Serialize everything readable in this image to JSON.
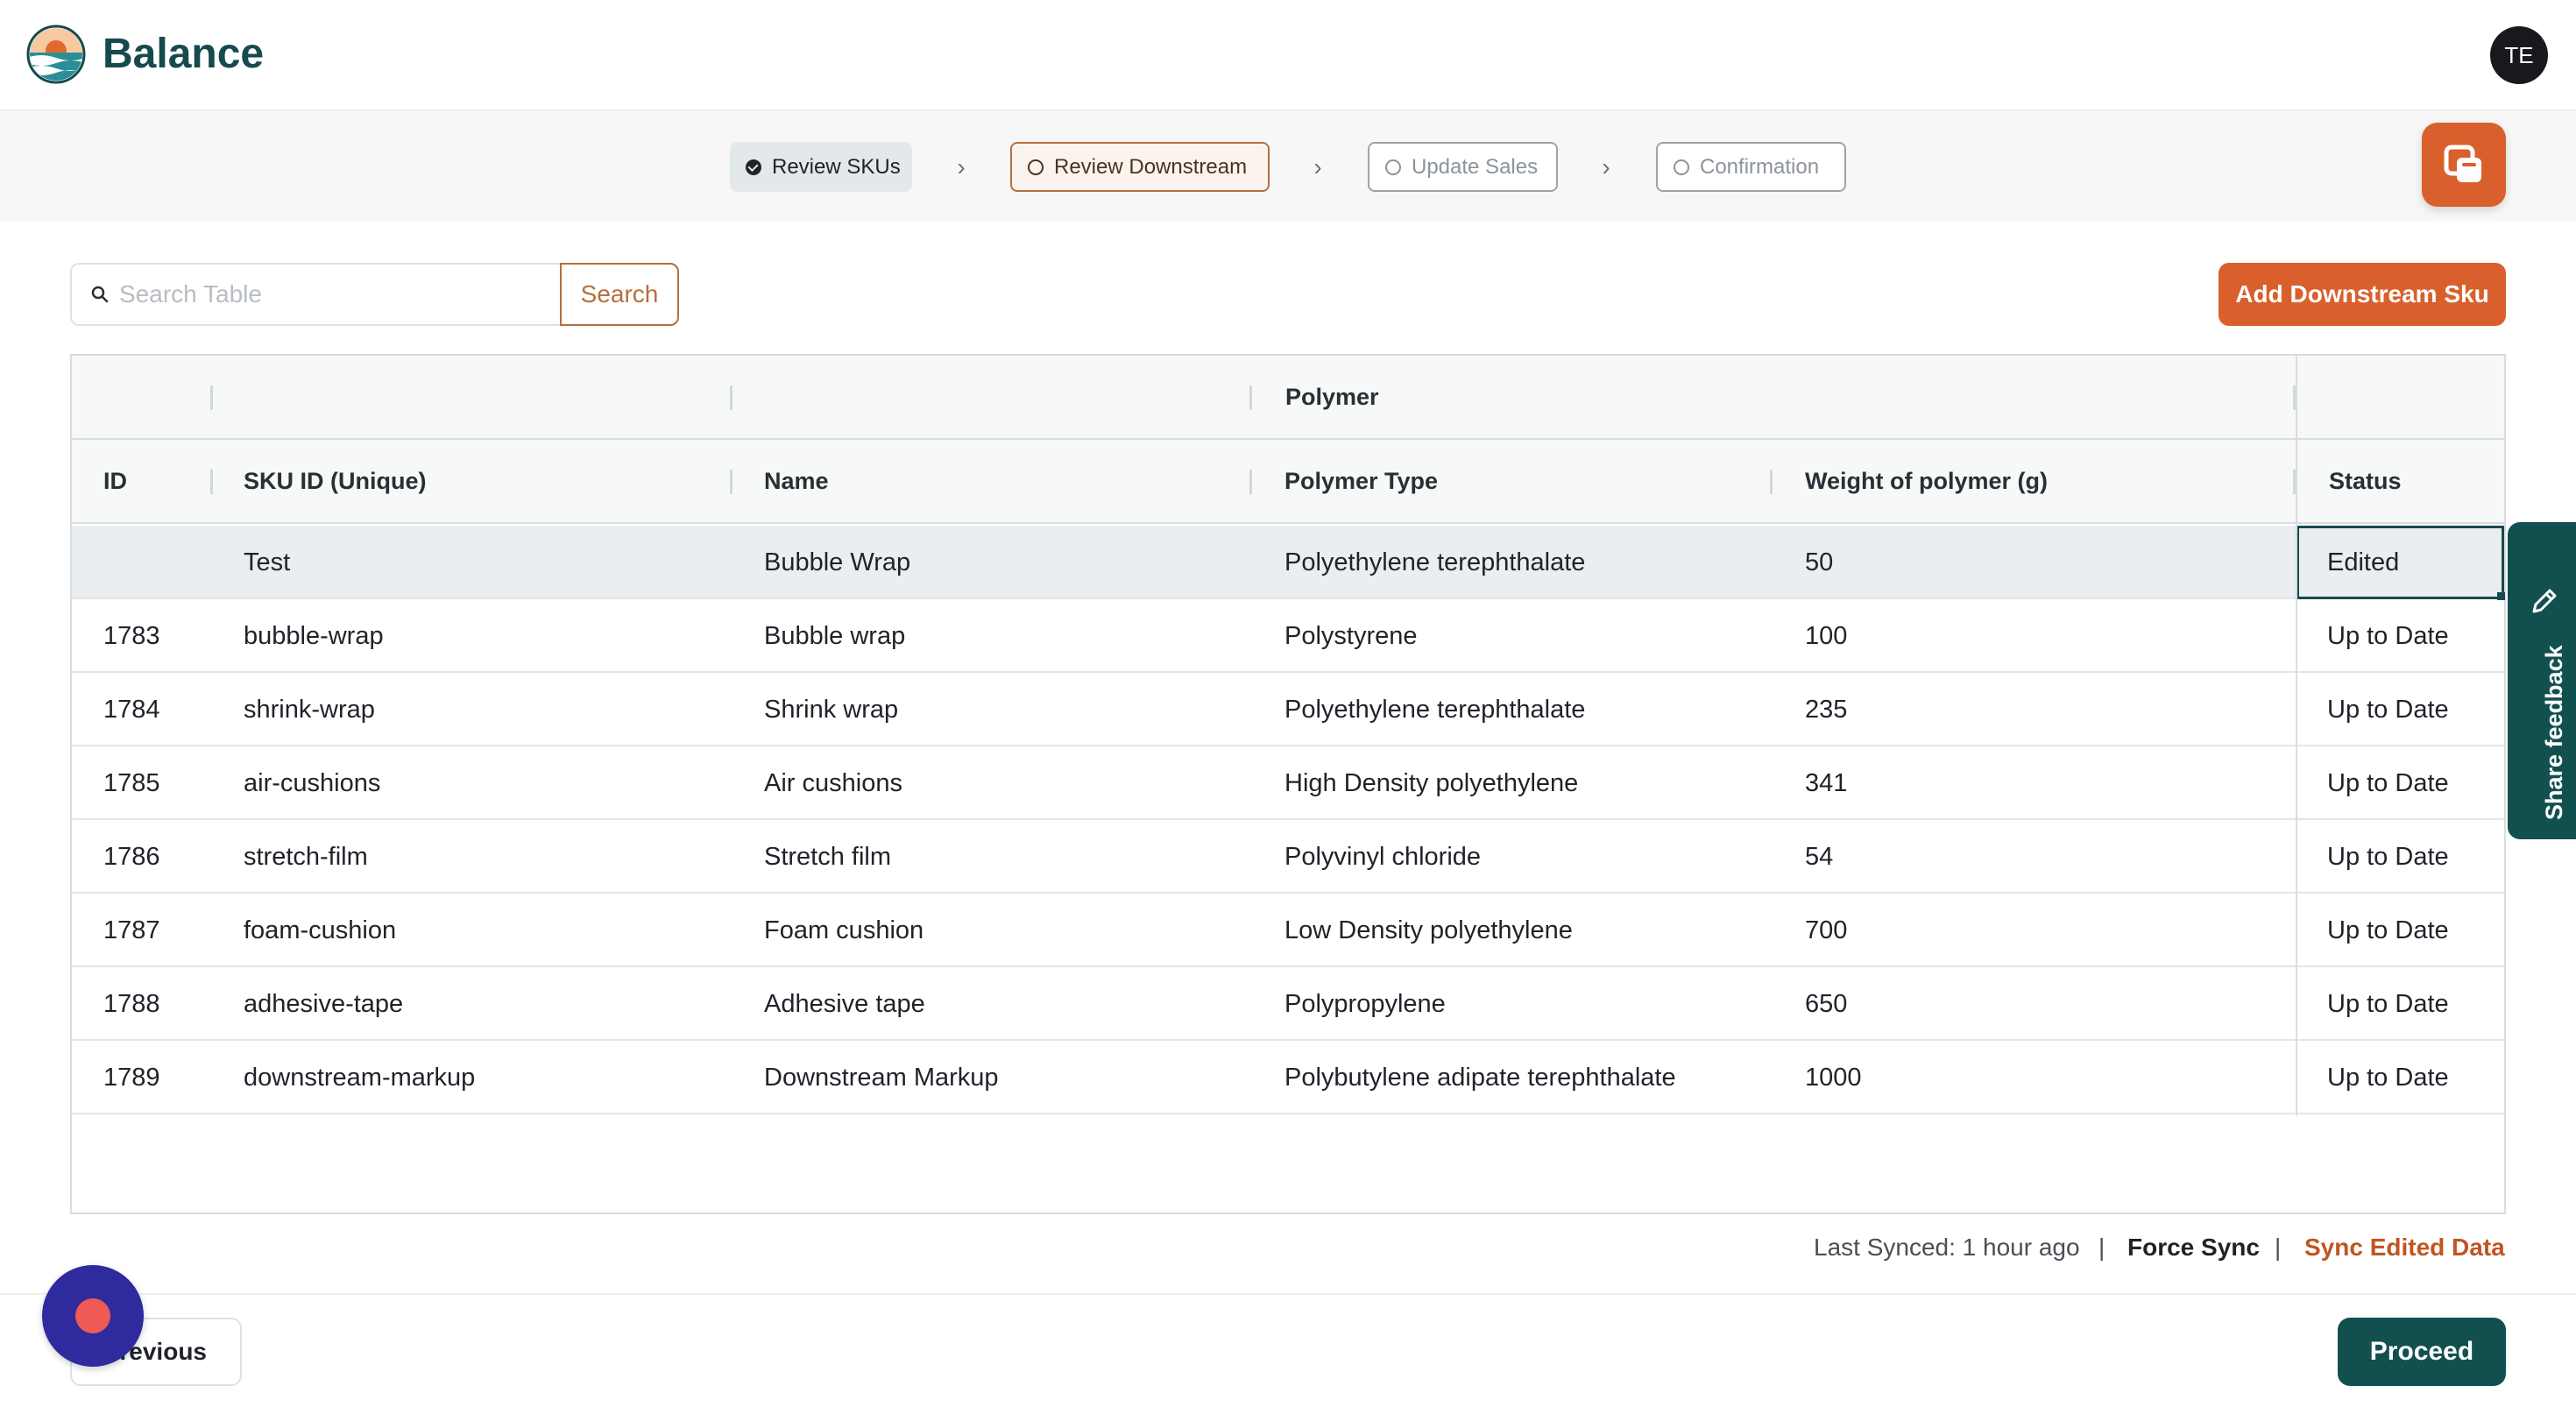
{
  "header": {
    "brand": "Balance",
    "avatar_initials": "TE"
  },
  "stepper": {
    "steps": [
      {
        "label": "Review SKUs",
        "state": "done"
      },
      {
        "label": "Review Downstream",
        "state": "active"
      },
      {
        "label": "Update Sales",
        "state": "pending"
      },
      {
        "label": "Confirmation",
        "state": "pending"
      }
    ],
    "separator_icon": "chevron-right-icon"
  },
  "toolbar": {
    "search_placeholder": "Search Table",
    "search_value": "",
    "search_label": "Search",
    "add_label": "Add Downstream Sku"
  },
  "table": {
    "group_header": "Polymer",
    "columns": [
      "ID",
      "SKU ID (Unique)",
      "Name",
      "Polymer Type",
      "Weight of polymer (g)",
      "Status"
    ],
    "rows": [
      [
        "",
        "Test",
        "Bubble Wrap",
        "Polyethylene terephthalate",
        "50",
        "Edited"
      ],
      [
        "1783",
        "bubble-wrap",
        "Bubble wrap",
        "Polystyrene",
        "100",
        "Up to Date"
      ],
      [
        "1784",
        "shrink-wrap",
        "Shrink wrap",
        "Polyethylene terephthalate",
        "235",
        "Up to Date"
      ],
      [
        "1785",
        "air-cushions",
        "Air cushions",
        "High Density polyethylene",
        "341",
        "Up to Date"
      ],
      [
        "1786",
        "stretch-film",
        "Stretch film",
        "Polyvinyl chloride",
        "54",
        "Up to Date"
      ],
      [
        "1787",
        "foam-cushion",
        "Foam cushion",
        "Low Density polyethylene",
        "700",
        "Up to Date"
      ],
      [
        "1788",
        "adhesive-tape",
        "Adhesive tape",
        "Polypropylene",
        "650",
        "Up to Date"
      ],
      [
        "1789",
        "downstream-markup",
        "Downstream Markup",
        "Polybutylene adipate terephthalate",
        "1000",
        "Up to Date"
      ]
    ]
  },
  "footer": {
    "last_synced": "Last Synced: 1 hour ago",
    "divider": "|",
    "force_sync": "Force Sync",
    "sync_edited": "Sync Edited Data",
    "previous_label": "Previous",
    "proceed_label": "Proceed"
  },
  "feedback": {
    "label": "Share feedback"
  },
  "colors": {
    "brand": "#174a4f",
    "accent": "#d9602c",
    "primary_dark": "#11504f",
    "recorder": "#2f2a9e"
  }
}
